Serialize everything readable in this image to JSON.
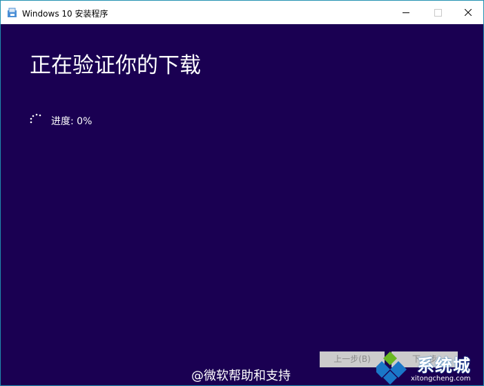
{
  "window": {
    "title": "Windows 10 安装程序"
  },
  "main": {
    "heading": "正在验证你的下载",
    "progress_text": "进度: 0%",
    "progress_percent": 0
  },
  "footer": {
    "back_label": "上一步(B)",
    "next_label": "下一步"
  },
  "watermarks": {
    "weibo": "@微软帮助和支持",
    "site_title": "系统城",
    "site_url": "xitongcheng.com"
  },
  "colors": {
    "background": "#1a0052",
    "titlebar": "#ffffff",
    "text": "#ffffff",
    "disabled_button": "#cccccc",
    "logo_blue": "#1a77c8",
    "logo_green": "#6ab823"
  },
  "icons": {
    "app": "setup-app-icon",
    "minimize": "minimize-icon",
    "maximize": "maximize-icon",
    "close": "close-icon",
    "spinner": "loading-spinner-icon",
    "logo": "xitongcheng-logo-icon"
  }
}
